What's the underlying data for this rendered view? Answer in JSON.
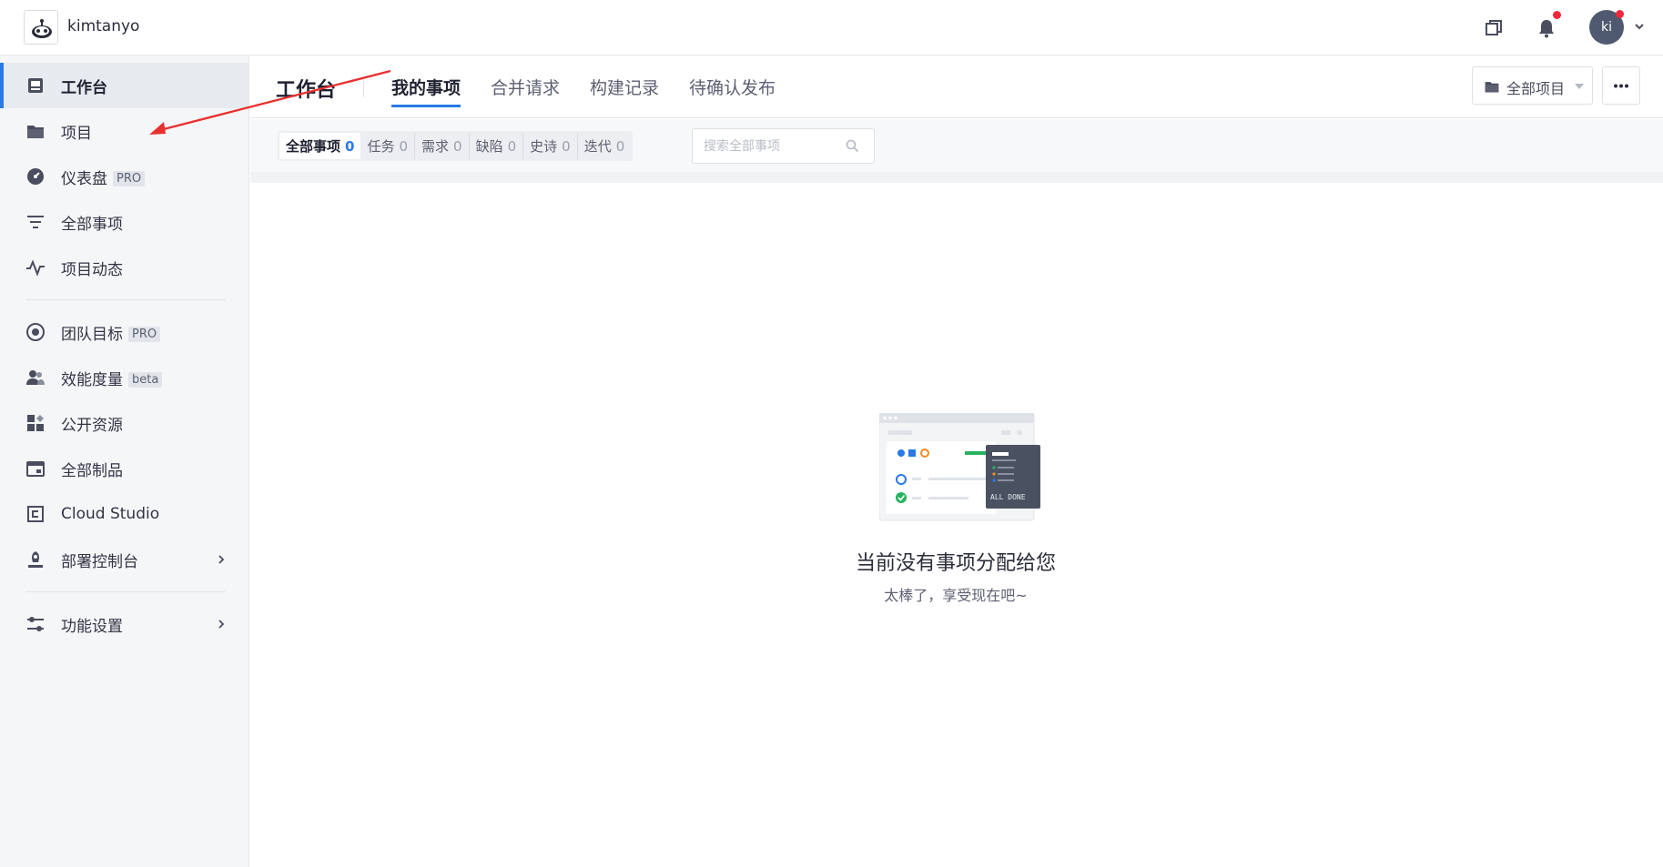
{
  "topbar": {
    "username": "kimtanyo",
    "avatar_initials": "ki",
    "notification_dot_color": "#f0283c"
  },
  "sidebar": {
    "items": [
      {
        "label": "工作台",
        "icon": "workbench-icon",
        "active": true
      },
      {
        "label": "项目",
        "icon": "folder-icon"
      },
      {
        "label": "仪表盘",
        "icon": "dashboard-icon",
        "badge": "PRO"
      },
      {
        "label": "全部事项",
        "icon": "filter-icon"
      },
      {
        "label": "项目动态",
        "icon": "activity-icon"
      },
      {
        "label": "团队目标",
        "icon": "target-icon",
        "badge": "PRO"
      },
      {
        "label": "效能度量",
        "icon": "users-metric-icon",
        "badge": "beta"
      },
      {
        "label": "公开资源",
        "icon": "grid-icon"
      },
      {
        "label": "全部制品",
        "icon": "artifact-icon"
      },
      {
        "label": "Cloud Studio",
        "icon": "cloud-studio-icon"
      },
      {
        "label": "部署控制台",
        "icon": "deploy-icon",
        "chevron": true
      },
      {
        "label": "功能设置",
        "icon": "settings-sliders-icon",
        "chevron": true
      }
    ]
  },
  "header": {
    "title": "工作台",
    "tabs": [
      {
        "label": "我的事项",
        "active": true
      },
      {
        "label": "合并请求"
      },
      {
        "label": "构建记录"
      },
      {
        "label": "待确认发布"
      }
    ],
    "project_select": "全部项目"
  },
  "filters": {
    "segments": [
      {
        "label": "全部事项",
        "count": "0",
        "active": true
      },
      {
        "label": "任务",
        "count": "0"
      },
      {
        "label": "需求",
        "count": "0"
      },
      {
        "label": "缺陷",
        "count": "0"
      },
      {
        "label": "史诗",
        "count": "0"
      },
      {
        "label": "迭代",
        "count": "0"
      }
    ],
    "search_placeholder": "搜索全部事项"
  },
  "empty_state": {
    "illustration_text": "ALL DONE",
    "title": "当前没有事项分配给您",
    "subtitle": "太棒了，享受现在吧~"
  },
  "colors": {
    "accent": "#2a79e7",
    "annotation_arrow": "#e8312f"
  }
}
